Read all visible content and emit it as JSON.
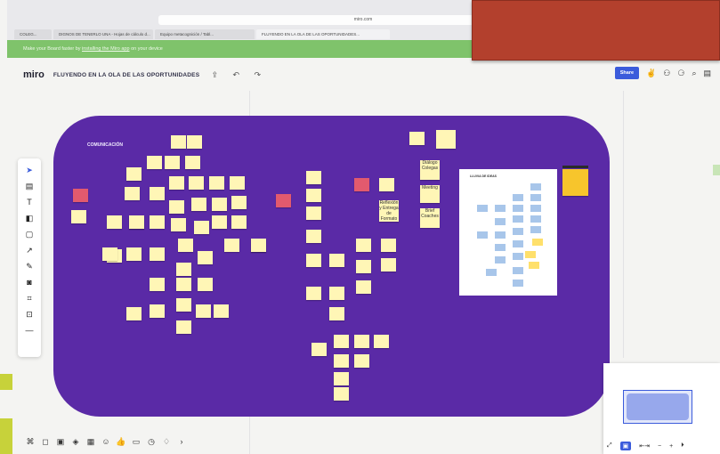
{
  "browser": {
    "url": "miro.com",
    "tabs": [
      {
        "label": "COLEG..."
      },
      {
        "label": "DIGNOS DE TENERLO UNA - Hojas de cálculo d..."
      },
      {
        "label": "Equipo metacognición / Tabl..."
      },
      {
        "label": "FLUYENDO EN LA OLA DE LAS OPORTUNIDADES...",
        "active": true
      }
    ],
    "notice": {
      "text_before": "Make your Board faster by ",
      "link": "installing the Miro app",
      "text_after": " on your device"
    }
  },
  "miro": {
    "logo": "miro",
    "board_title": "FLUYENDO EN LA OLA DE LAS OPORTUNIDADES",
    "share_label": "Share",
    "icons": {
      "upload": "upload-icon",
      "undo": "undo-icon",
      "redo": "redo-icon",
      "search": "search-icon",
      "notes": "notes-icon"
    }
  },
  "frame": {
    "label": "COMUNICACIÓN",
    "color": "#5a2aa6",
    "cards": [
      {
        "text": "Diálogo Colegas"
      },
      {
        "text": "Meeting"
      },
      {
        "text": "Brief Coaches"
      },
      {
        "text": "Reflexión y Entrega de Formato"
      }
    ],
    "doc_title": "LLUVIA DE IDEAS"
  },
  "left_tools": [
    {
      "name": "select-tool",
      "icon": "cursor-icon",
      "glyph": "➤"
    },
    {
      "name": "templates-tool",
      "icon": "templates-icon",
      "glyph": "▤"
    },
    {
      "name": "text-tool",
      "icon": "text-icon",
      "glyph": "T"
    },
    {
      "name": "sticky-tool",
      "icon": "sticky-note-icon",
      "glyph": "◧"
    },
    {
      "name": "shape-tool",
      "icon": "shape-icon",
      "glyph": "▢"
    },
    {
      "name": "connector-tool",
      "icon": "arrow-icon",
      "glyph": "↗"
    },
    {
      "name": "pen-tool",
      "icon": "pen-icon",
      "glyph": "✎"
    },
    {
      "name": "comment-tool",
      "icon": "comment-icon",
      "glyph": "◙"
    },
    {
      "name": "frame-tool",
      "icon": "frame-icon",
      "glyph": "⌗"
    },
    {
      "name": "upload-tool",
      "icon": "upload-icon",
      "glyph": "⊡"
    },
    {
      "name": "more-tool",
      "icon": "more-icon",
      "glyph": "—"
    }
  ],
  "bottom_tools": [
    {
      "name": "grid-tool",
      "icon": "grid-icon",
      "glyph": "⌘"
    },
    {
      "name": "chat-tool",
      "icon": "chat-icon",
      "glyph": "◻"
    },
    {
      "name": "comment-tool",
      "icon": "comment-icon",
      "glyph": "▣"
    },
    {
      "name": "share-screen-tool",
      "icon": "screen-icon",
      "glyph": "◈"
    },
    {
      "name": "apps-tool",
      "icon": "apps-icon",
      "glyph": "▦"
    },
    {
      "name": "reactions-tool",
      "icon": "reaction-icon",
      "glyph": "☺"
    },
    {
      "name": "like-tool",
      "icon": "like-icon",
      "glyph": "👍"
    },
    {
      "name": "video-tool",
      "icon": "video-icon",
      "glyph": "▭"
    },
    {
      "name": "timer-tool",
      "icon": "timer-icon",
      "glyph": "◷"
    },
    {
      "name": "voting-tool",
      "icon": "voting-icon",
      "glyph": "♢"
    },
    {
      "name": "more-tool",
      "icon": "more-icon",
      "glyph": "›"
    }
  ],
  "minimap": {
    "controls": [
      "⤢",
      "▣",
      "⇤⇥",
      "−",
      "+",
      "⏵"
    ]
  },
  "colors": {
    "frame": "#5a2aa6",
    "sticky": "#fff6b6",
    "sticky_pink": "#e25a6e",
    "accent": "#3b5bdb",
    "notice": "#7fc36b",
    "overlay": "#b3402d"
  }
}
